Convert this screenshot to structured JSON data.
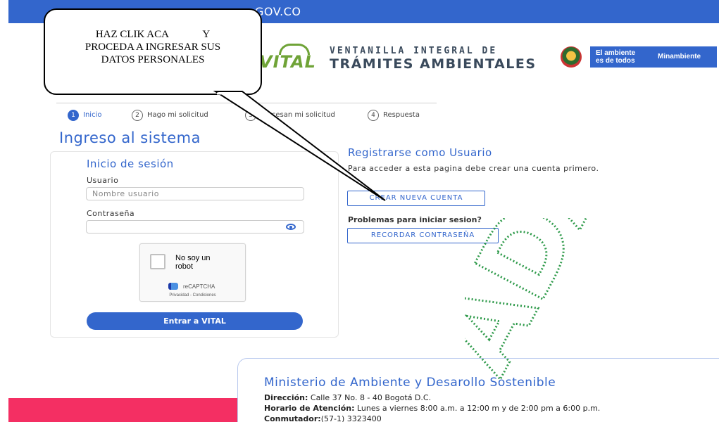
{
  "gov_bar": {
    "text": "GOV.CO",
    "color": "#3366cc"
  },
  "brand": {
    "logo_word": "VITAL",
    "line1": "VENTANILLA INTEGRAL DE",
    "line2": "TRÁMITES AMBIENTALES",
    "ambiente_line1": "El ambiente",
    "ambiente_line2": "es de todos",
    "ministry_short": "Minambiente"
  },
  "callout": {
    "line1": "HAZ CLIK ACA             Y",
    "line2": "PROCEDA A INGRESAR SUS",
    "line3": "DATOS PERSONALES"
  },
  "steps": [
    {
      "num": "1",
      "label": "Inicio"
    },
    {
      "num": "2",
      "label": "Hago mi solicitud"
    },
    {
      "num": "3",
      "label": "Procesan mi solicitud"
    },
    {
      "num": "4",
      "label": "Respuesta"
    }
  ],
  "page_title": "Ingreso al sistema",
  "login": {
    "title": "Inicio de sesión",
    "user_label": "Usuario",
    "user_placeholder": "Nombre usuario",
    "password_label": "Contraseña",
    "captcha": {
      "text": "No soy un robot",
      "brand": "reCAPTCHA",
      "links": "Privacidad - Condiciones"
    },
    "submit": "Entrar a VITAL"
  },
  "register": {
    "title": "Registrarse como Usuario",
    "text": "Para acceder a esta pagina debe crear una cuenta primero.",
    "create_button": "CREAR NUEVA CUENTA",
    "forgot_title": "Problemas para iniciar sesion?",
    "forgot_button": "RECORDAR CONTRASEÑA"
  },
  "footer": {
    "title": "Ministerio de Ambiente y Desarollo Sostenible",
    "address_label": "Dirección:",
    "address": "Calle 37 No. 8 - 40 Bogotá D.C.",
    "hours_label": "Horario de Atención:",
    "hours": "Lunes a viernes 8:00 a.m. a 12:00 m y de 2:00 pm a 6:00 p.m.",
    "phone_label": "Conmutador:",
    "phone": "(57-1) 3323400"
  },
  "stamp": {
    "text": "ADA"
  },
  "colors": {
    "primary": "#3366cc",
    "vital_green": "#6fa337",
    "accent_pink": "#f42f63"
  }
}
